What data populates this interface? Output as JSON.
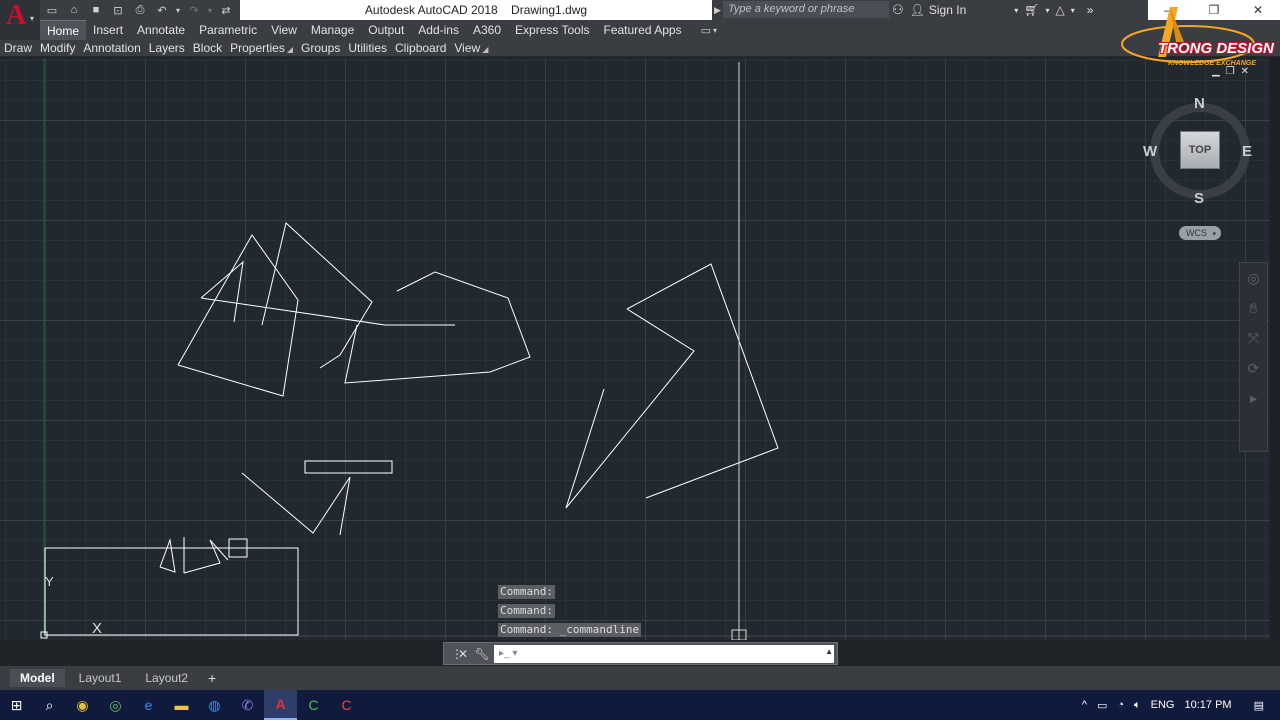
{
  "window": {
    "app_name": "Autodesk AutoCAD 2018",
    "document": "Drawing1.dwg"
  },
  "search": {
    "placeholder": "Type a keyword or phrase"
  },
  "account": {
    "sign_in": "Sign In"
  },
  "ribbon": {
    "tabs": [
      "Home",
      "Insert",
      "Annotate",
      "Parametric",
      "View",
      "Manage",
      "Output",
      "Add-ins",
      "A360",
      "Express Tools",
      "Featured Apps"
    ],
    "active_tab": "Home",
    "panels": [
      "Draw",
      "Modify",
      "Annotation",
      "Layers",
      "Block",
      "Properties",
      "Groups",
      "Utilities",
      "Clipboard",
      "View"
    ]
  },
  "viewcube": {
    "top_label": "TOP",
    "north": "N",
    "south": "S",
    "east": "E",
    "west": "W",
    "wcs_label": "WCS"
  },
  "ucs": {
    "x_label": "X",
    "y_label": "Y"
  },
  "command": {
    "history": [
      "Command:",
      "Command:",
      "Command: _commandline"
    ],
    "input_value": ""
  },
  "layout_tabs": {
    "tabs": [
      "Model",
      "Layout1",
      "Layout2"
    ],
    "active": "Model"
  },
  "taskbar": {
    "language": "ENG",
    "time": "10:17 PM"
  },
  "watermark": {
    "brand": "TRONG DESIGN",
    "tagline": "KNOWLEDGE EXCHANGE"
  },
  "colors": {
    "canvas_bg": "#212830",
    "linework": "#ffffff",
    "crosshair": "#d8d8d8",
    "brand_red": "#c8102e",
    "watermark_orange": "#f5a623"
  }
}
